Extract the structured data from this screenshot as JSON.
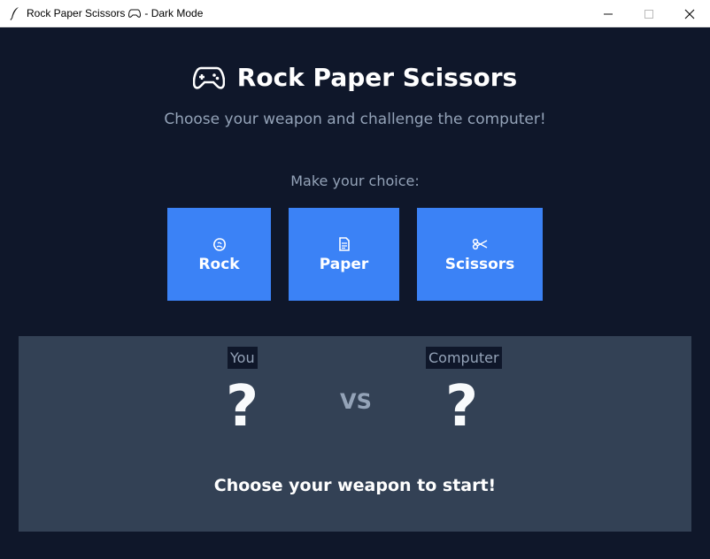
{
  "window": {
    "title_prefix": "Rock Paper Scissors",
    "title_suffix": "- Dark Mode",
    "icon": "feather-icon",
    "controls": [
      "minimize-icon",
      "maximize-icon",
      "close-icon"
    ]
  },
  "header": {
    "icon": "gamepad-icon",
    "title": "Rock Paper Scissors",
    "subtitle": "Choose your weapon and challenge the computer!"
  },
  "choices": {
    "prompt": "Make your choice:",
    "items": [
      {
        "label": "Rock",
        "icon": "rock-icon"
      },
      {
        "label": "Paper",
        "icon": "paper-icon"
      },
      {
        "label": "Scissors",
        "icon": "scissors-icon"
      }
    ]
  },
  "battle": {
    "player_label": "You",
    "computer_label": "Computer",
    "player_choice": "?",
    "computer_choice": "?",
    "vs": "VS",
    "result": "Choose your weapon to start!"
  },
  "colors": {
    "background": "#0f172a",
    "panel": "#334155",
    "button": "#3b82f6",
    "muted_text": "#94a3b8",
    "text": "#ffffff"
  }
}
